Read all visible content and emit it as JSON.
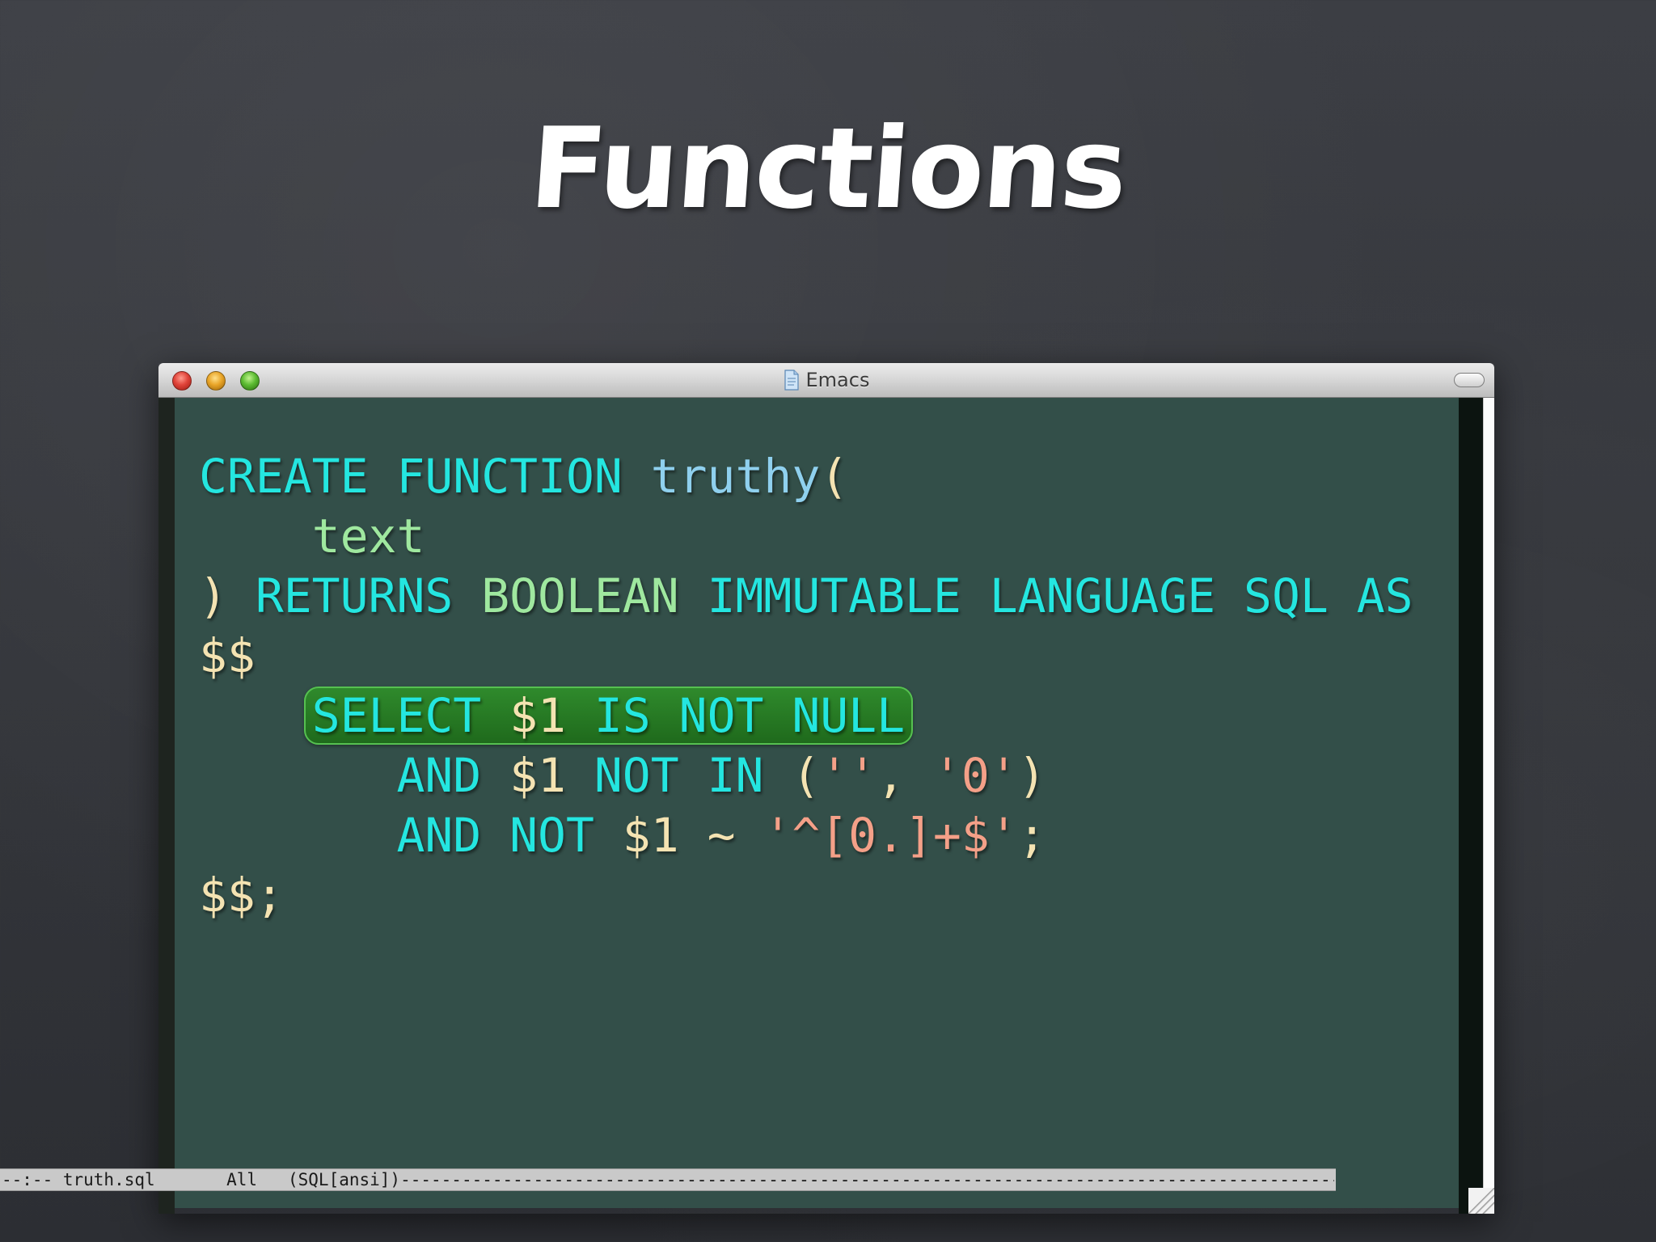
{
  "slide": {
    "title": "Functions"
  },
  "window": {
    "title": "Emacs",
    "buttons": {
      "close": "close",
      "minimize": "minimize",
      "zoom": "zoom"
    }
  },
  "editor": {
    "lines": [
      [
        {
          "text": "CREATE",
          "role": "kw"
        },
        {
          "text": " ",
          "role": "pn"
        },
        {
          "text": "FUNCTION",
          "role": "kw"
        },
        {
          "text": " ",
          "role": "pn"
        },
        {
          "text": "truthy",
          "role": "fn"
        },
        {
          "text": "(",
          "role": "pn"
        }
      ],
      [
        {
          "text": "    ",
          "role": "pn"
        },
        {
          "text": "text",
          "role": "ty"
        }
      ],
      [
        {
          "text": ") ",
          "role": "pn"
        },
        {
          "text": "RETURNS",
          "role": "kw"
        },
        {
          "text": " ",
          "role": "pn"
        },
        {
          "text": "BOOLEAN",
          "role": "ty"
        },
        {
          "text": " ",
          "role": "pn"
        },
        {
          "text": "IMMUTABLE",
          "role": "kw"
        },
        {
          "text": " ",
          "role": "pn"
        },
        {
          "text": "LANGUAGE",
          "role": "kw"
        },
        {
          "text": " ",
          "role": "pn"
        },
        {
          "text": "SQL",
          "role": "kw"
        },
        {
          "text": " ",
          "role": "pn"
        },
        {
          "text": "AS",
          "role": "kw"
        }
      ],
      [
        {
          "text": "$$",
          "role": "pn"
        }
      ],
      [
        {
          "text": "    ",
          "role": "pn"
        },
        {
          "text": "SELECT",
          "role": "kw",
          "group": "hl"
        },
        {
          "text": " $1 ",
          "role": "pn",
          "group": "hl"
        },
        {
          "text": "IS",
          "role": "kw",
          "group": "hl"
        },
        {
          "text": " ",
          "role": "pn",
          "group": "hl"
        },
        {
          "text": "NOT",
          "role": "kw",
          "group": "hl"
        },
        {
          "text": " ",
          "role": "pn",
          "group": "hl"
        },
        {
          "text": "NULL",
          "role": "kw",
          "group": "hl"
        }
      ],
      [
        {
          "text": "       ",
          "role": "pn"
        },
        {
          "text": "AND",
          "role": "kw"
        },
        {
          "text": " $1 ",
          "role": "pn"
        },
        {
          "text": "NOT",
          "role": "kw"
        },
        {
          "text": " ",
          "role": "pn"
        },
        {
          "text": "IN",
          "role": "kw"
        },
        {
          "text": " (",
          "role": "pn"
        },
        {
          "text": "''",
          "role": "str"
        },
        {
          "text": ", ",
          "role": "pn"
        },
        {
          "text": "'0'",
          "role": "str"
        },
        {
          "text": ")",
          "role": "pn"
        }
      ],
      [
        {
          "text": "       ",
          "role": "pn"
        },
        {
          "text": "AND",
          "role": "kw"
        },
        {
          "text": " ",
          "role": "pn"
        },
        {
          "text": "NOT",
          "role": "kw"
        },
        {
          "text": " $1 ~ ",
          "role": "pn"
        },
        {
          "text": "'^[0.]+$'",
          "role": "str"
        },
        {
          "text": ";",
          "role": "pn"
        }
      ],
      [
        {
          "text": "$$;",
          "role": "pn"
        }
      ]
    ]
  },
  "modeline": {
    "text": "--:-- truth.sql       All   (SQL[ansi])-----------------------------------------------------------------------------------------------------------------------------------"
  },
  "colors": {
    "keyword": "#24e6e0",
    "function_name": "#8fd0ee",
    "type": "#9fe89f",
    "plain": "#f4e3b2",
    "string": "#f4a088",
    "editor_background": "#334f49",
    "highlight": "#2f8a2c"
  },
  "icons": {
    "document": "document-icon",
    "toolbar_toggle": "toolbar-toggle-icon",
    "resize": "resize-grip-icon"
  }
}
